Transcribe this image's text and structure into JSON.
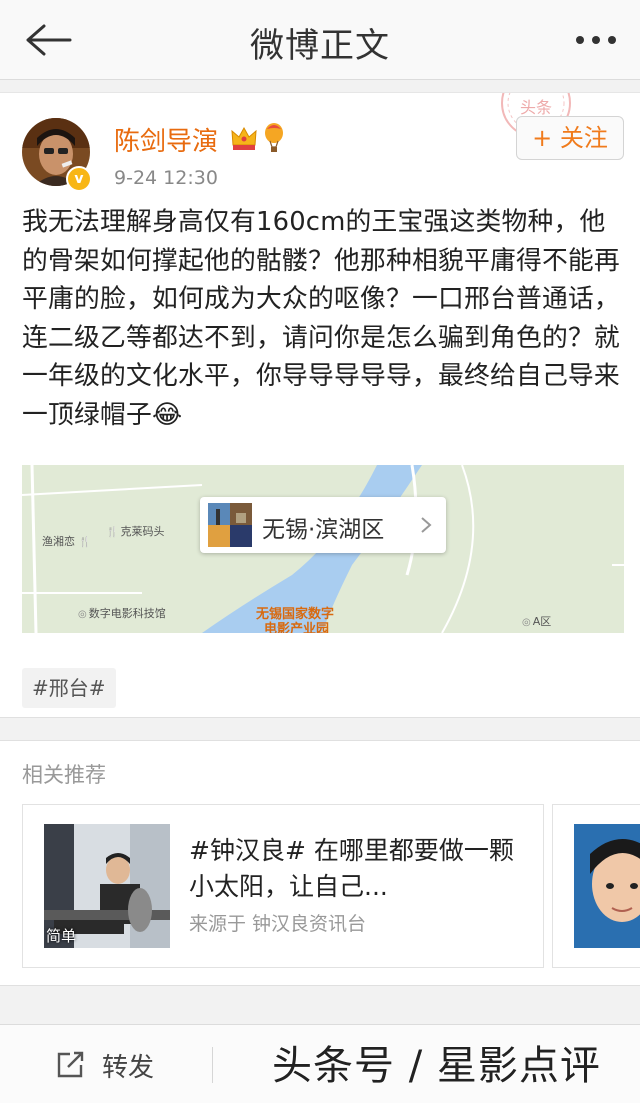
{
  "header": {
    "title": "微博正文"
  },
  "post": {
    "author": "陈剑导演",
    "time": "9-24 12:30",
    "follow_label": "+ 关注",
    "text": "我无法理解身高仅有160cm的王宝强这类物种，他的骨架如何撑起他的骷髅？他那种相貌平庸得不能再平庸的脸，如何成为大众的呕像？一口邢台普通话，连二级乙等都达不到，请问你是怎么骗到角色的？就一年级的文化水平，你导导导导导，最终给自己导来一顶绿帽子",
    "emoji": "😂",
    "verified_mark": "v",
    "location": "无锡·滨湖区",
    "tag": "#邢台#",
    "stamp_text": "头条"
  },
  "map": {
    "labels": [
      "渔湘恋",
      "克莱码头",
      "数字电影科技馆",
      "A区"
    ],
    "highlight": [
      "无锡国家数字",
      "电影产业园"
    ]
  },
  "recommend": {
    "header": "相关推荐",
    "items": [
      {
        "title": "#钟汉良# 在哪里都要做一颗小太阳，让自己...",
        "source": "来源于 钟汉良资讯台",
        "thumb_label": "简单"
      }
    ]
  },
  "bottom": {
    "repost_label": "转发",
    "watermark": "头条号 / 星影点评"
  },
  "colors": {
    "author": "#e86b0f",
    "follow": "#f07b1c",
    "badge": "#f8b616"
  }
}
